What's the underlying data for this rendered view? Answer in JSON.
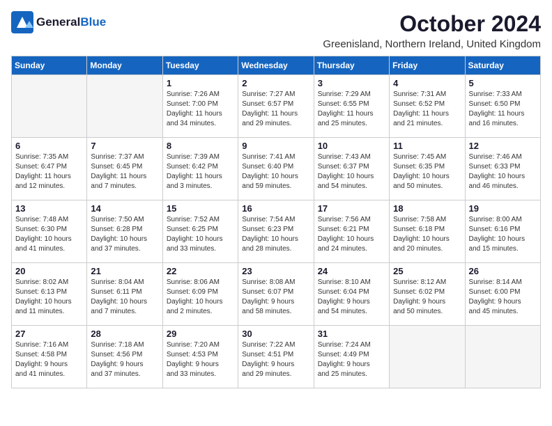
{
  "header": {
    "logo_general": "General",
    "logo_blue": "Blue",
    "month_title": "October 2024",
    "location": "Greenisland, Northern Ireland, United Kingdom"
  },
  "days_of_week": [
    "Sunday",
    "Monday",
    "Tuesday",
    "Wednesday",
    "Thursday",
    "Friday",
    "Saturday"
  ],
  "weeks": [
    [
      {
        "day": "",
        "info": ""
      },
      {
        "day": "",
        "info": ""
      },
      {
        "day": "1",
        "info": "Sunrise: 7:26 AM\nSunset: 7:00 PM\nDaylight: 11 hours\nand 34 minutes."
      },
      {
        "day": "2",
        "info": "Sunrise: 7:27 AM\nSunset: 6:57 PM\nDaylight: 11 hours\nand 29 minutes."
      },
      {
        "day": "3",
        "info": "Sunrise: 7:29 AM\nSunset: 6:55 PM\nDaylight: 11 hours\nand 25 minutes."
      },
      {
        "day": "4",
        "info": "Sunrise: 7:31 AM\nSunset: 6:52 PM\nDaylight: 11 hours\nand 21 minutes."
      },
      {
        "day": "5",
        "info": "Sunrise: 7:33 AM\nSunset: 6:50 PM\nDaylight: 11 hours\nand 16 minutes."
      }
    ],
    [
      {
        "day": "6",
        "info": "Sunrise: 7:35 AM\nSunset: 6:47 PM\nDaylight: 11 hours\nand 12 minutes."
      },
      {
        "day": "7",
        "info": "Sunrise: 7:37 AM\nSunset: 6:45 PM\nDaylight: 11 hours\nand 7 minutes."
      },
      {
        "day": "8",
        "info": "Sunrise: 7:39 AM\nSunset: 6:42 PM\nDaylight: 11 hours\nand 3 minutes."
      },
      {
        "day": "9",
        "info": "Sunrise: 7:41 AM\nSunset: 6:40 PM\nDaylight: 10 hours\nand 59 minutes."
      },
      {
        "day": "10",
        "info": "Sunrise: 7:43 AM\nSunset: 6:37 PM\nDaylight: 10 hours\nand 54 minutes."
      },
      {
        "day": "11",
        "info": "Sunrise: 7:45 AM\nSunset: 6:35 PM\nDaylight: 10 hours\nand 50 minutes."
      },
      {
        "day": "12",
        "info": "Sunrise: 7:46 AM\nSunset: 6:33 PM\nDaylight: 10 hours\nand 46 minutes."
      }
    ],
    [
      {
        "day": "13",
        "info": "Sunrise: 7:48 AM\nSunset: 6:30 PM\nDaylight: 10 hours\nand 41 minutes."
      },
      {
        "day": "14",
        "info": "Sunrise: 7:50 AM\nSunset: 6:28 PM\nDaylight: 10 hours\nand 37 minutes."
      },
      {
        "day": "15",
        "info": "Sunrise: 7:52 AM\nSunset: 6:25 PM\nDaylight: 10 hours\nand 33 minutes."
      },
      {
        "day": "16",
        "info": "Sunrise: 7:54 AM\nSunset: 6:23 PM\nDaylight: 10 hours\nand 28 minutes."
      },
      {
        "day": "17",
        "info": "Sunrise: 7:56 AM\nSunset: 6:21 PM\nDaylight: 10 hours\nand 24 minutes."
      },
      {
        "day": "18",
        "info": "Sunrise: 7:58 AM\nSunset: 6:18 PM\nDaylight: 10 hours\nand 20 minutes."
      },
      {
        "day": "19",
        "info": "Sunrise: 8:00 AM\nSunset: 6:16 PM\nDaylight: 10 hours\nand 15 minutes."
      }
    ],
    [
      {
        "day": "20",
        "info": "Sunrise: 8:02 AM\nSunset: 6:13 PM\nDaylight: 10 hours\nand 11 minutes."
      },
      {
        "day": "21",
        "info": "Sunrise: 8:04 AM\nSunset: 6:11 PM\nDaylight: 10 hours\nand 7 minutes."
      },
      {
        "day": "22",
        "info": "Sunrise: 8:06 AM\nSunset: 6:09 PM\nDaylight: 10 hours\nand 2 minutes."
      },
      {
        "day": "23",
        "info": "Sunrise: 8:08 AM\nSunset: 6:07 PM\nDaylight: 9 hours\nand 58 minutes."
      },
      {
        "day": "24",
        "info": "Sunrise: 8:10 AM\nSunset: 6:04 PM\nDaylight: 9 hours\nand 54 minutes."
      },
      {
        "day": "25",
        "info": "Sunrise: 8:12 AM\nSunset: 6:02 PM\nDaylight: 9 hours\nand 50 minutes."
      },
      {
        "day": "26",
        "info": "Sunrise: 8:14 AM\nSunset: 6:00 PM\nDaylight: 9 hours\nand 45 minutes."
      }
    ],
    [
      {
        "day": "27",
        "info": "Sunrise: 7:16 AM\nSunset: 4:58 PM\nDaylight: 9 hours\nand 41 minutes."
      },
      {
        "day": "28",
        "info": "Sunrise: 7:18 AM\nSunset: 4:56 PM\nDaylight: 9 hours\nand 37 minutes."
      },
      {
        "day": "29",
        "info": "Sunrise: 7:20 AM\nSunset: 4:53 PM\nDaylight: 9 hours\nand 33 minutes."
      },
      {
        "day": "30",
        "info": "Sunrise: 7:22 AM\nSunset: 4:51 PM\nDaylight: 9 hours\nand 29 minutes."
      },
      {
        "day": "31",
        "info": "Sunrise: 7:24 AM\nSunset: 4:49 PM\nDaylight: 9 hours\nand 25 minutes."
      },
      {
        "day": "",
        "info": ""
      },
      {
        "day": "",
        "info": ""
      }
    ]
  ]
}
